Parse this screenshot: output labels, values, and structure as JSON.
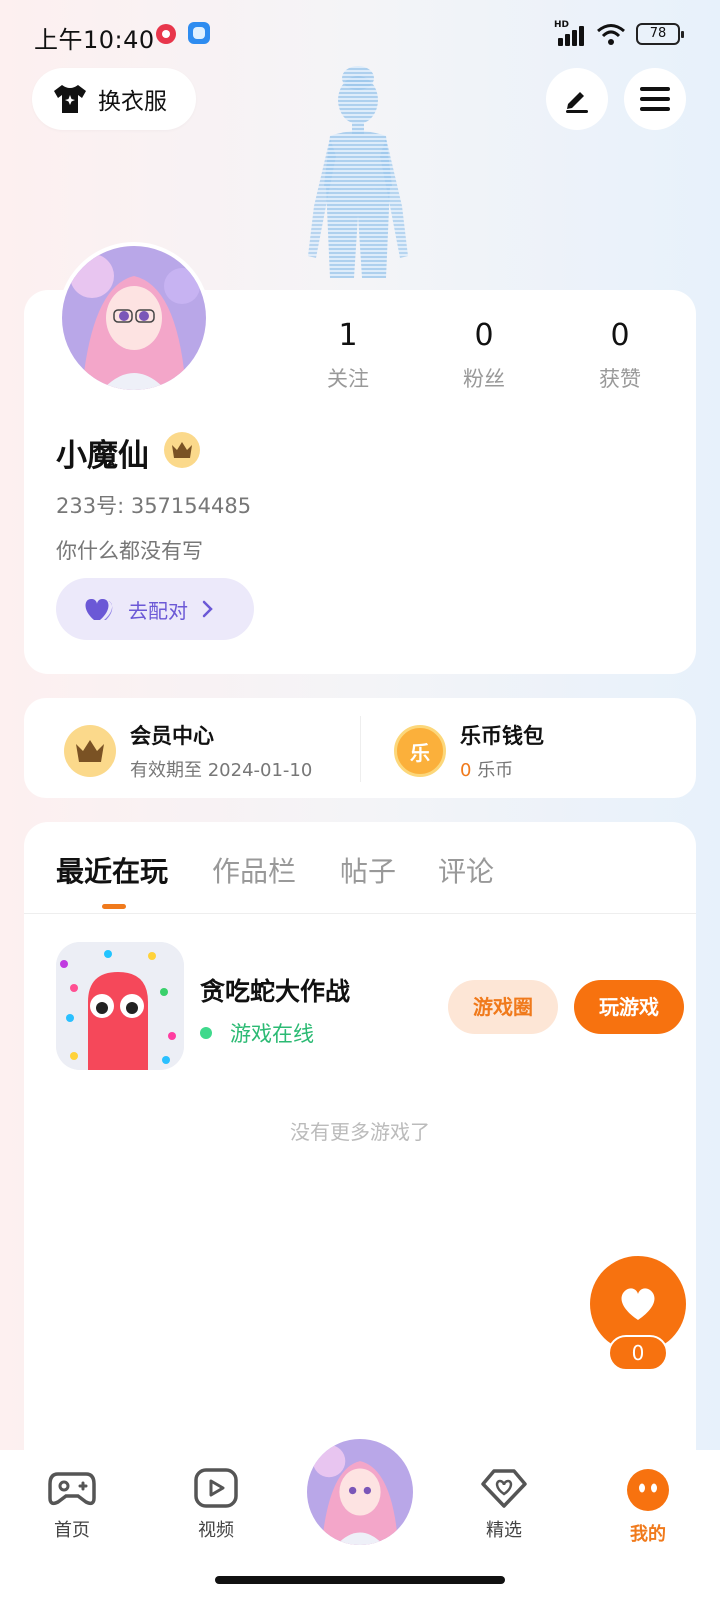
{
  "status_bar": {
    "time": "上午10:40",
    "network_label": "HD",
    "battery": "78"
  },
  "header": {
    "outfit_label": "换衣服"
  },
  "profile": {
    "nickname": "小魔仙",
    "user_id": "233号: 357154485",
    "bio": "你什么都没有写",
    "match_label": "去配对",
    "stats": [
      {
        "value": "1",
        "label": "关注"
      },
      {
        "value": "0",
        "label": "粉丝"
      },
      {
        "value": "0",
        "label": "获赞"
      }
    ]
  },
  "membership": {
    "title": "会员中心",
    "subtitle": "有效期至 2024-01-10"
  },
  "wallet": {
    "coin_glyph": "乐",
    "title": "乐币钱包",
    "amount": "0",
    "unit": "乐币"
  },
  "tabs": [
    {
      "label": "最近在玩",
      "active": true
    },
    {
      "label": "作品栏",
      "active": false
    },
    {
      "label": "帖子",
      "active": false
    },
    {
      "label": "评论",
      "active": false
    }
  ],
  "recent_game": {
    "title": "贪吃蛇大作战",
    "status": "游戏在线",
    "circle_button": "游戏圈",
    "play_button": "玩游戏"
  },
  "empty_hint": "没有更多游戏了",
  "like": {
    "count": "0"
  },
  "bottom_nav": [
    {
      "label": "首页",
      "icon": "gamepad-icon"
    },
    {
      "label": "视频",
      "icon": "video-icon"
    },
    {
      "label": "精选",
      "icon": "heart-box-icon"
    },
    {
      "label": "我的",
      "icon": "face-icon",
      "active": true
    }
  ],
  "colors": {
    "accent": "#f7720f",
    "match": "#6b58d6",
    "online": "#2bba73"
  }
}
